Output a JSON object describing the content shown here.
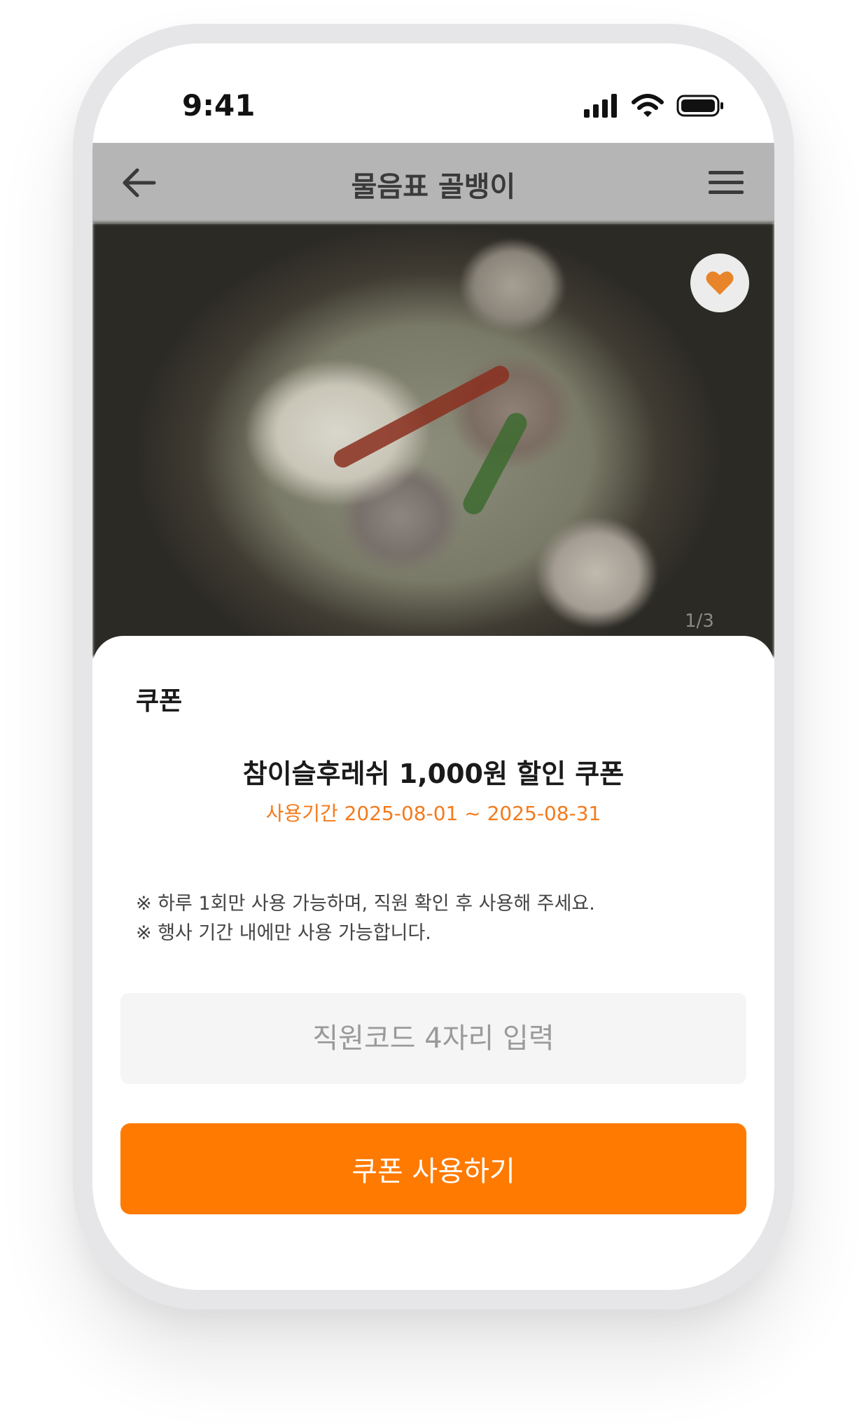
{
  "status_bar": {
    "time": "9:41"
  },
  "header": {
    "title": "물음표 골뱅이"
  },
  "photo": {
    "counter": "1/3"
  },
  "coupon_sheet": {
    "title": "쿠폰",
    "coupon_name": "참이슬후레쉬 1,000원 할인 쿠폰",
    "period": "사용기간 2025-08-01 ~ 2025-08-31",
    "notices": [
      "※ 하루 1회만 사용 가능하며, 직원 확인 후 사용해 주세요.",
      "※ 행사 기간 내에만 사용 가능합니다."
    ],
    "code_input": {
      "placeholder": "직원코드 4자리 입력",
      "value": ""
    },
    "use_button_label": "쿠폰 사용하기"
  },
  "colors": {
    "accent": "#ff7a00",
    "period_text": "#f47a1b",
    "header_dim": "#b5b5b5",
    "heart": "#e8842a"
  }
}
